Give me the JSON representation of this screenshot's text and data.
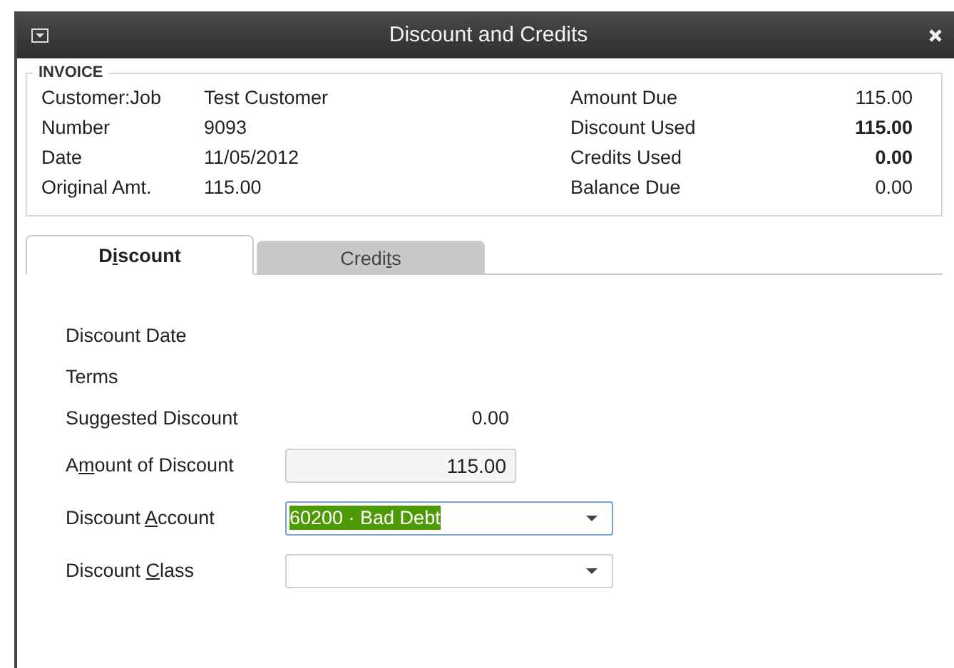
{
  "window": {
    "title": "Discount and Credits"
  },
  "invoice": {
    "legend": "INVOICE",
    "left": [
      {
        "label": "Customer:Job",
        "value": "Test Customer"
      },
      {
        "label": "Number",
        "value": "9093"
      },
      {
        "label": "Date",
        "value": "11/05/2012"
      },
      {
        "label": "Original Amt.",
        "value": "115.00"
      }
    ],
    "right": [
      {
        "label": "Amount Due",
        "value": "115.00",
        "bold": false
      },
      {
        "label": "Discount Used",
        "value": "115.00",
        "bold": true
      },
      {
        "label": "Credits Used",
        "value": "0.00",
        "bold": true
      },
      {
        "label": "Balance Due",
        "value": "0.00",
        "bold": false
      }
    ]
  },
  "tabs": [
    {
      "label_parts": [
        "D",
        "i",
        "scount"
      ],
      "selected": true
    },
    {
      "label_parts": [
        "Credi",
        "t",
        "s"
      ],
      "selected": false
    }
  ],
  "discount": [
    {
      "kind": "text",
      "label_parts": [
        "Discount Date"
      ]
    },
    {
      "kind": "text",
      "label_parts": [
        "Terms"
      ]
    },
    {
      "kind": "text",
      "label_parts": [
        "Suggested Discount"
      ],
      "value": "0.00"
    },
    {
      "kind": "input",
      "label_parts": [
        "A",
        "m",
        "ount of Discount"
      ],
      "value": "115.00"
    },
    {
      "kind": "select",
      "label_parts": [
        "Discount ",
        "A",
        "ccount"
      ],
      "value": "60200 · Bad Debt",
      "focused": true
    },
    {
      "kind": "select",
      "label_parts": [
        "Discount ",
        "C",
        "lass"
      ],
      "focused": false
    }
  ]
}
